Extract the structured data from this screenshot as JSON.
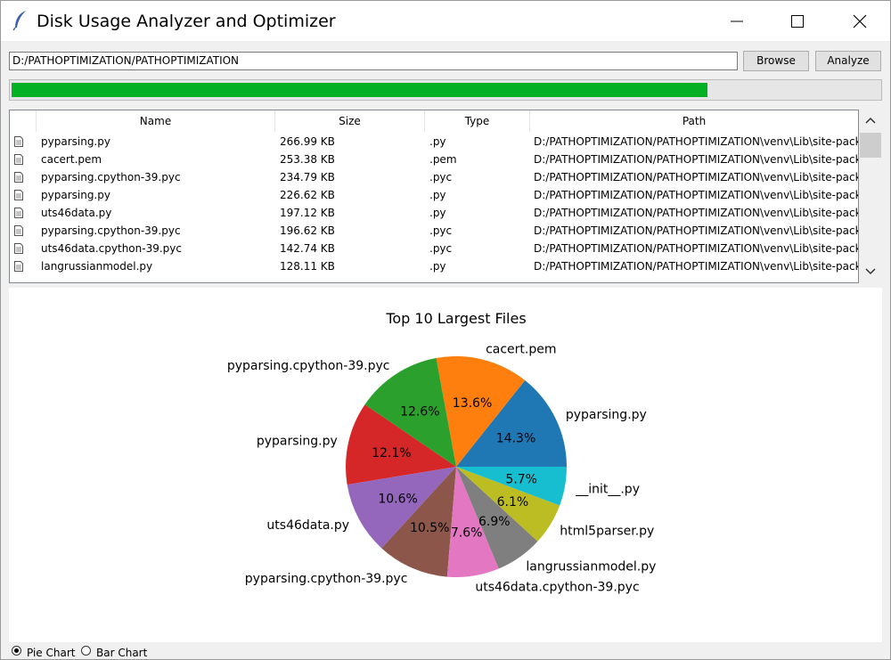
{
  "window": {
    "title": "Disk Usage Analyzer and Optimizer"
  },
  "toolbar": {
    "path_value": "D:/PATHOPTIMIZATION/PATHOPTIMIZATION",
    "browse_label": "Browse",
    "analyze_label": "Analyze"
  },
  "progress": {
    "fraction": 0.8
  },
  "table": {
    "columns": [
      "Name",
      "Size",
      "Type",
      "Path"
    ],
    "rows": [
      {
        "name": "pyparsing.py",
        "size": "266.99 KB",
        "type": ".py",
        "path": "D:/PATHOPTIMIZATION/PATHOPTIMIZATION\\venv\\Lib\\site-packag"
      },
      {
        "name": "cacert.pem",
        "size": "253.38 KB",
        "type": ".pem",
        "path": "D:/PATHOPTIMIZATION/PATHOPTIMIZATION\\venv\\Lib\\site-packag"
      },
      {
        "name": "pyparsing.cpython-39.pyc",
        "size": "234.79 KB",
        "type": ".pyc",
        "path": "D:/PATHOPTIMIZATION/PATHOPTIMIZATION\\venv\\Lib\\site-packag"
      },
      {
        "name": "pyparsing.py",
        "size": "226.62 KB",
        "type": ".py",
        "path": "D:/PATHOPTIMIZATION/PATHOPTIMIZATION\\venv\\Lib\\site-packag"
      },
      {
        "name": "uts46data.py",
        "size": "197.12 KB",
        "type": ".py",
        "path": "D:/PATHOPTIMIZATION/PATHOPTIMIZATION\\venv\\Lib\\site-packag"
      },
      {
        "name": "pyparsing.cpython-39.pyc",
        "size": "196.62 KB",
        "type": ".pyc",
        "path": "D:/PATHOPTIMIZATION/PATHOPTIMIZATION\\venv\\Lib\\site-packag"
      },
      {
        "name": "uts46data.cpython-39.pyc",
        "size": "142.74 KB",
        "type": ".pyc",
        "path": "D:/PATHOPTIMIZATION/PATHOPTIMIZATION\\venv\\Lib\\site-packag"
      },
      {
        "name": "langrussianmodel.py",
        "size": "128.11 KB",
        "type": ".py",
        "path": "D:/PATHOPTIMIZATION/PATHOPTIMIZATION\\venv\\Lib\\site-packag"
      }
    ]
  },
  "chart_data": {
    "type": "pie",
    "title": "Top 10 Largest Files",
    "slices": [
      {
        "label": "pyparsing.py",
        "value": 14.3,
        "pct": "14.3%",
        "color": "#1f77b4"
      },
      {
        "label": "cacert.pem",
        "value": 13.6,
        "pct": "13.6%",
        "color": "#ff7f0e"
      },
      {
        "label": "pyparsing.cpython-39.pyc",
        "value": 12.6,
        "pct": "12.6%",
        "color": "#2ca02c"
      },
      {
        "label": "pyparsing.py",
        "value": 12.1,
        "pct": "12.1%",
        "color": "#d62728"
      },
      {
        "label": "uts46data.py",
        "value": 10.6,
        "pct": "10.6%",
        "color": "#9467bd"
      },
      {
        "label": "pyparsing.cpython-39.pyc",
        "value": 10.5,
        "pct": "10.5%",
        "color": "#8c564b"
      },
      {
        "label": "uts46data.cpython-39.pyc",
        "value": 7.6,
        "pct": "7.6%",
        "color": "#e377c2"
      },
      {
        "label": "langrussianmodel.py",
        "value": 6.9,
        "pct": "6.9%",
        "color": "#7f7f7f"
      },
      {
        "label": "html5parser.py",
        "value": 6.1,
        "pct": "6.1%",
        "color": "#bcbd22"
      },
      {
        "label": "__init__.py",
        "value": 5.7,
        "pct": "5.7%",
        "color": "#17becf"
      }
    ]
  },
  "chart_options": {
    "pie_label": "Pie Chart",
    "bar_label": "Bar Chart",
    "selected": "pie"
  },
  "colors": {
    "progress": "#06b025"
  }
}
